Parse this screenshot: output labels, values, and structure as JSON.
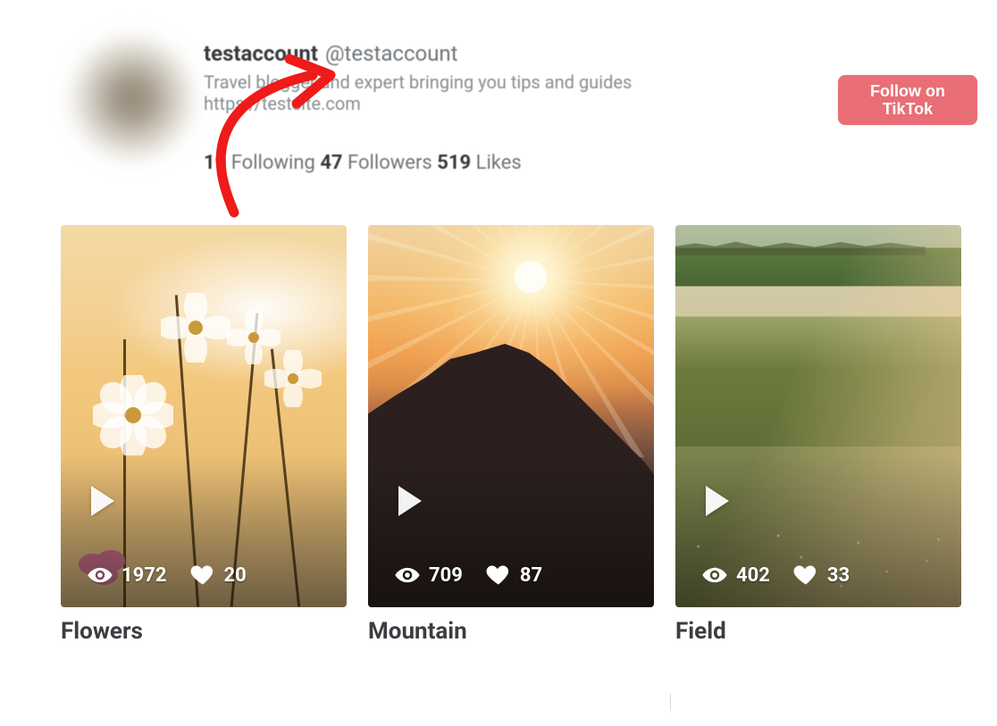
{
  "profile": {
    "display_name": "testaccount",
    "handle": "@testaccount",
    "bio_line1": "Travel blogger and expert bringing you tips and guides",
    "bio_line2": "https://testsite.com",
    "following_value": "19",
    "following_label": "Following",
    "followers_value": "47",
    "followers_label": "Followers",
    "likes_value": "519",
    "likes_label": "Likes"
  },
  "follow_button": "Follow on\nTikTok",
  "posts": [
    {
      "title": "Flowers",
      "views": "1972",
      "likes": "20"
    },
    {
      "title": "Mountain",
      "views": "709",
      "likes": "87"
    },
    {
      "title": "Field",
      "views": "402",
      "likes": "33"
    }
  ],
  "colors": {
    "accent": "#e96e75"
  }
}
